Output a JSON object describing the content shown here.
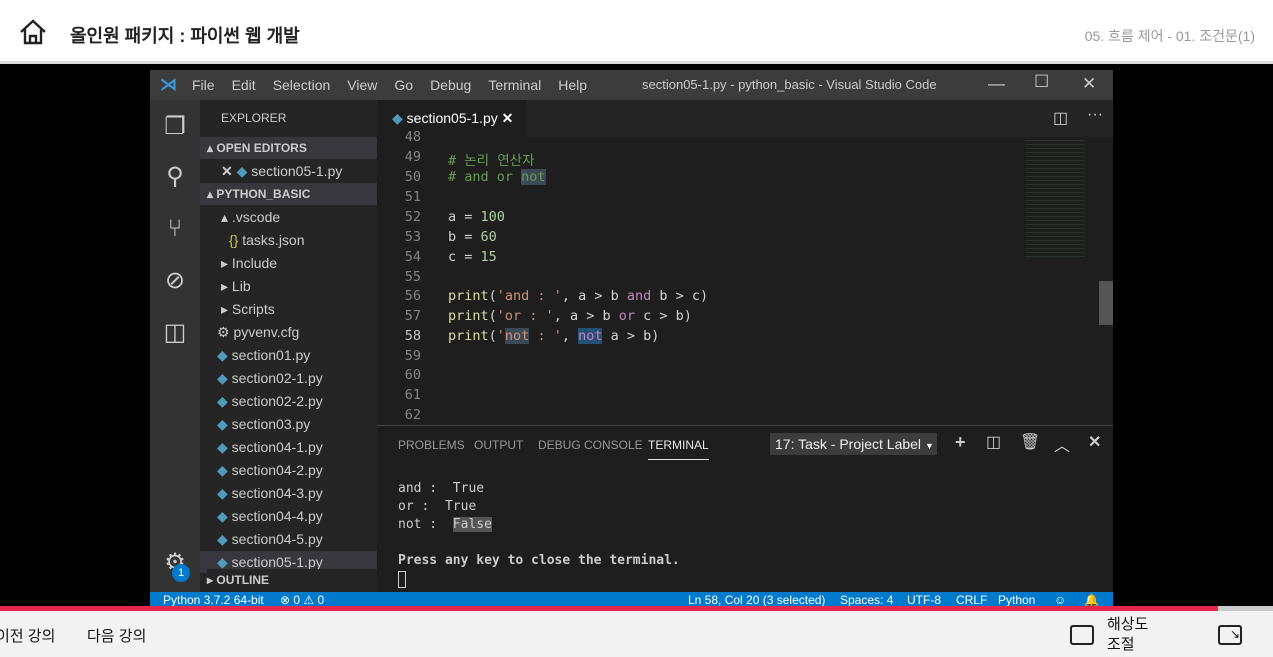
{
  "header": {
    "course_title": "올인원 패키지 : 파이썬 웹 개발",
    "lesson": "05. 흐름 제어 - 01. 조건문(1)"
  },
  "vscode": {
    "menu": [
      "File",
      "Edit",
      "Selection",
      "View",
      "Go",
      "Debug",
      "Terminal",
      "Help"
    ],
    "window_title": "section05-1.py - python_basic - Visual Studio Code",
    "explorer_label": "EXPLORER",
    "open_editors": "OPEN EDITORS",
    "open_file": "section05-1.py",
    "project": "PYTHON_BASIC",
    "tree": [
      ".vscode",
      "tasks.json",
      "Include",
      "Lib",
      "Scripts",
      "pyvenv.cfg",
      "section01.py",
      "section02-1.py",
      "section02-2.py",
      "section03.py",
      "section04-1.py",
      "section04-2.py",
      "section04-3.py",
      "section04-4.py",
      "section04-5.py",
      "section05-1.py"
    ],
    "outline": "OUTLINE",
    "settings_badge": "1",
    "tab": "section05-1.py",
    "line_numbers": [
      "48",
      "49",
      "50",
      "51",
      "52",
      "53",
      "54",
      "55",
      "56",
      "57",
      "58",
      "59",
      "60",
      "61",
      "62"
    ],
    "code": {
      "l49": "# 논리 연산자",
      "l50a": "# and or ",
      "l50b": "not",
      "l52a": "a = ",
      "l52b": "100",
      "l53a": "b = ",
      "l53b": "60",
      "l54a": "c = ",
      "l54b": "15",
      "print": "print",
      "s56": "'and : '",
      "r56a": ", a > b ",
      "and": "and",
      "r56b": " b > c)",
      "s57": "'or : '",
      "r57a": ", a > b ",
      "or": "or",
      "r57b": " c > b)",
      "s58a": "'",
      "s58not": "not",
      "s58b": " : '",
      "comma": ", ",
      "not": "not",
      "r58": " a > b)",
      "paren": "("
    },
    "panel_tabs": [
      "PROBLEMS",
      "OUTPUT",
      "DEBUG CONSOLE",
      "TERMINAL"
    ],
    "terminal_select": "17: Task - Project Label",
    "terminal": {
      "l1": "and :  True",
      "l2": "or :  True",
      "l3a": "not :  ",
      "l3b": "False",
      "l4": "Press any key to close the terminal."
    },
    "status": {
      "python": "Python 3.7.2 64-bit",
      "problems": "⊗ 0 ⚠ 0",
      "position": "Ln 58, Col 20 (3 selected)",
      "spaces": "Spaces: 4",
      "encoding": "UTF-8",
      "eol": "CRLF",
      "language": "Python"
    }
  },
  "progress": 0.957,
  "bottom": {
    "prev": "이전 강의",
    "next": "다음 강의",
    "resolution": "해상도 조절"
  },
  "colors": {
    "accent": "#e8264e",
    "status_bar": "#007acc"
  }
}
